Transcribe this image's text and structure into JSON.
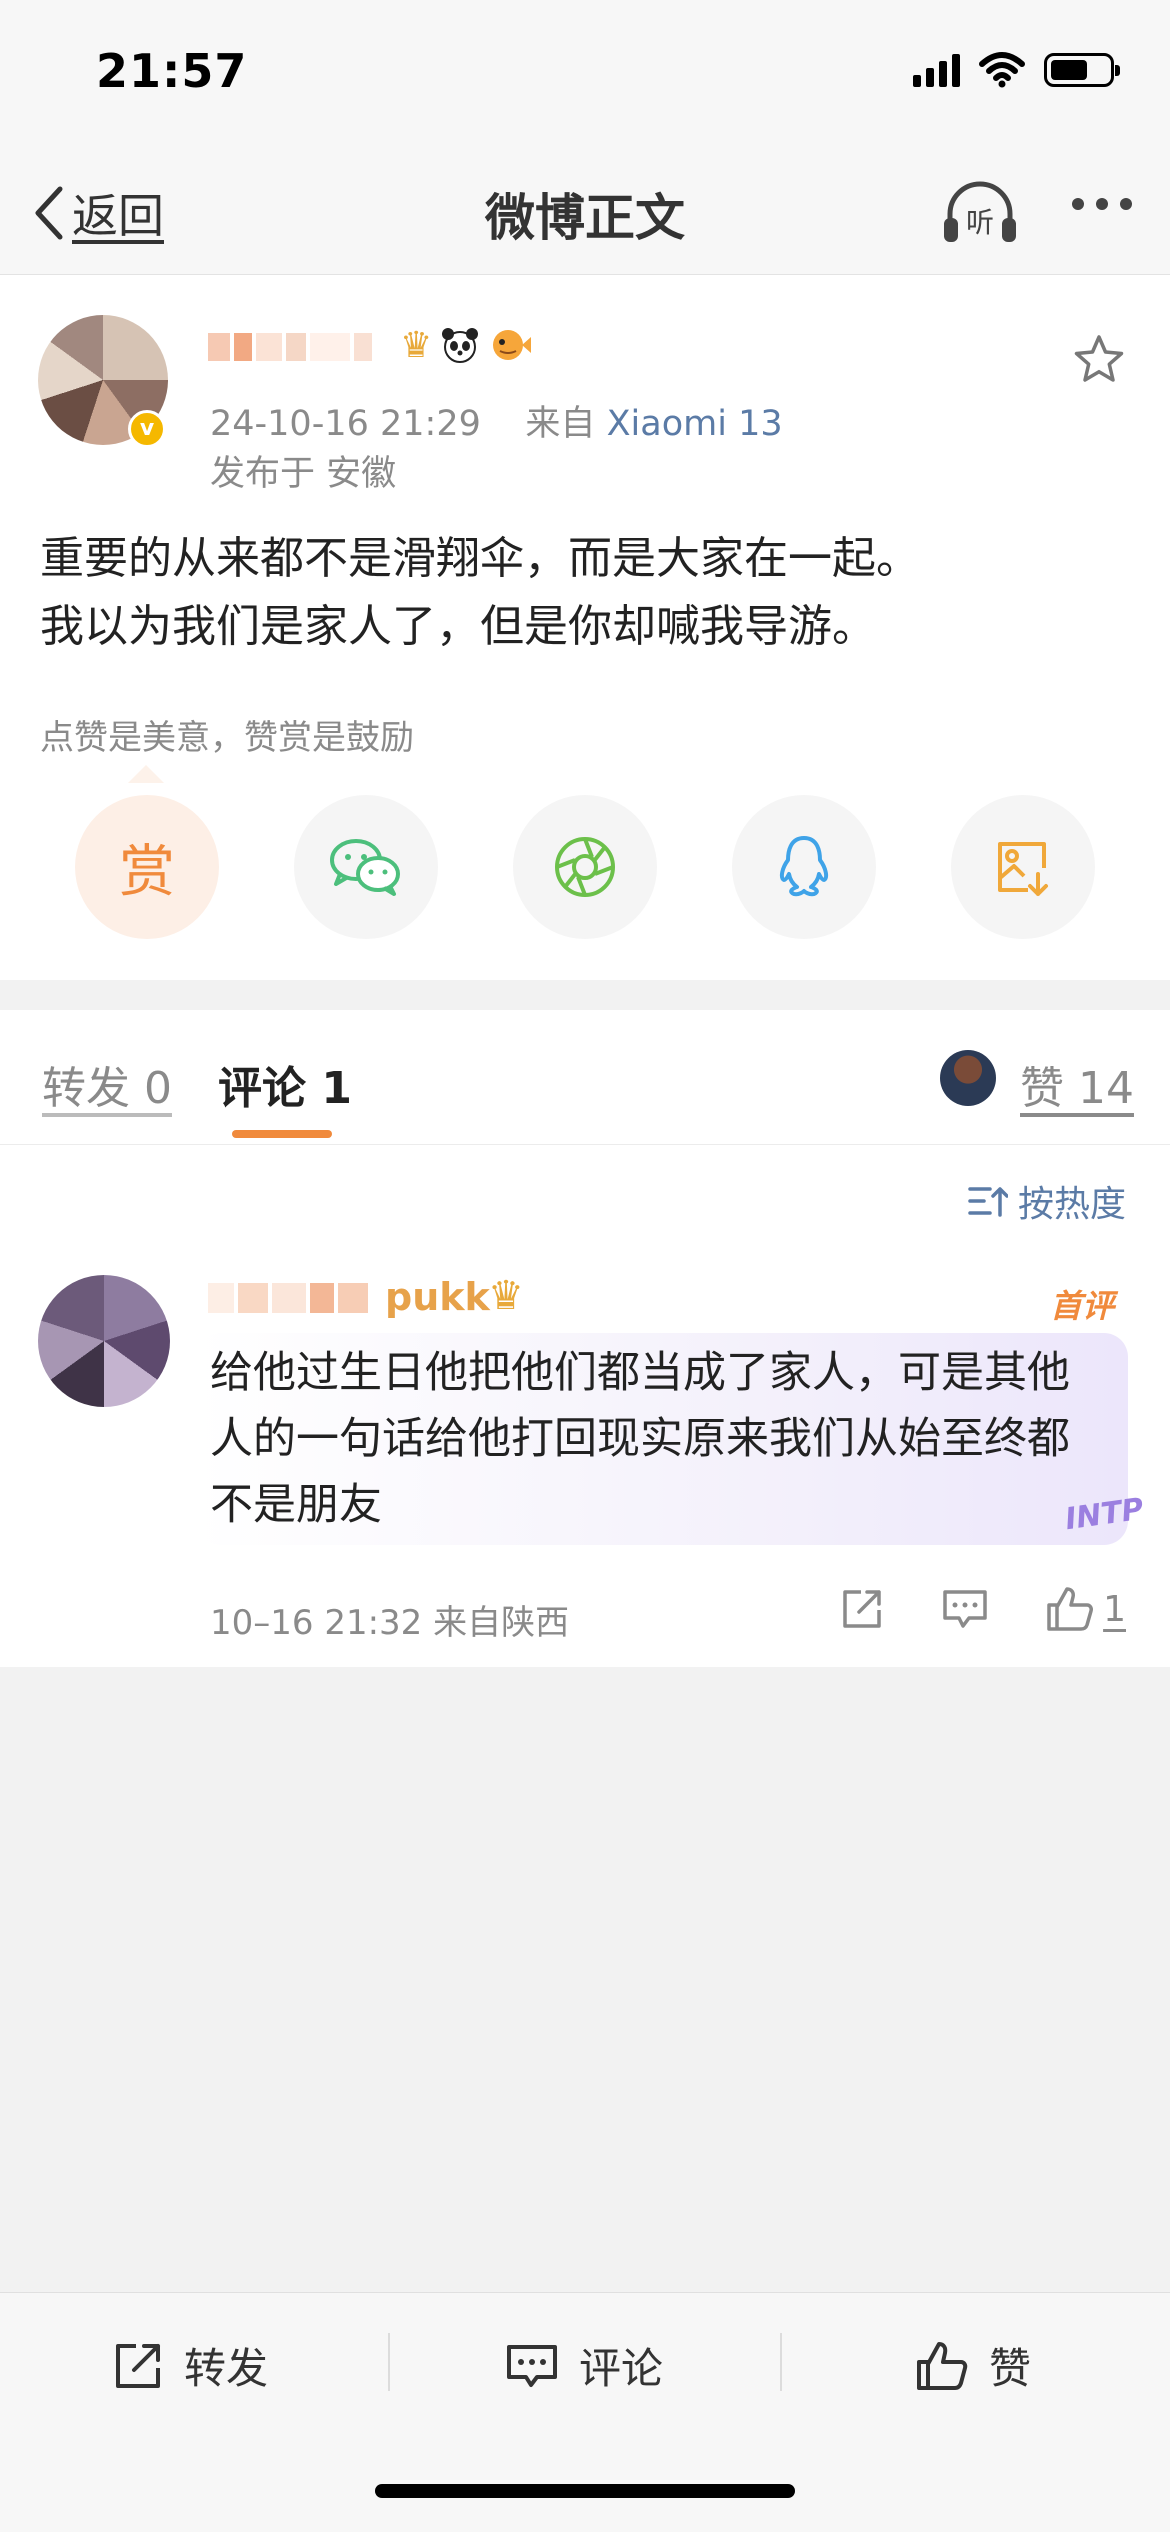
{
  "status_bar": {
    "time": "21:57"
  },
  "nav": {
    "back_label": "返回",
    "title": "微博正文",
    "listen_label": "听"
  },
  "post": {
    "timestamp": "24-10-16 21:29",
    "source_prefix": "来自",
    "device": "Xiaomi 13",
    "location": "发布于 安徽",
    "text_line1": "重要的从来都不是滑翔伞，而是大家在一起。",
    "text_line2": "我以为我们是家人了，但是你却喊我导游。",
    "reward_hint": "点赞是美意，赞赏是鼓励",
    "reward_label": "赏",
    "badge_icons": [
      "crown-badge",
      "panda-badge",
      "pufferfish-badge"
    ]
  },
  "tabs": {
    "repost": "转发 0",
    "comments": "评论 1",
    "likes": "赞 14"
  },
  "comments": {
    "sort_label": "按热度",
    "items": [
      {
        "name_suffix": "pukk",
        "first_tag": "首评",
        "text": "给他过生日他把他们都当成了家人，可是其他人的一句话给他打回现实原来我们从始至终都不是朋友",
        "bubble_tag": "INTP",
        "meta": "10–16 21:32  来自陕西",
        "like_count": "1"
      }
    ]
  },
  "bottom_bar": {
    "repost": "转发",
    "comment": "评论",
    "like": "赞"
  },
  "colors": {
    "accent": "#f08a3c",
    "link": "#5b7ba6",
    "muted": "#8a8a8a"
  }
}
